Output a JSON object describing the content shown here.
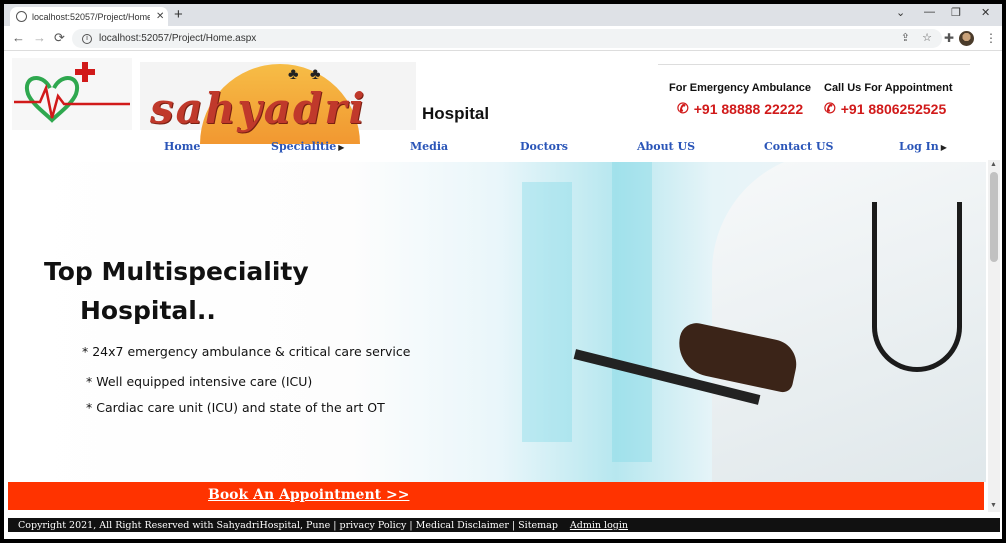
{
  "browser": {
    "tab_title": "localhost:52057/Project/Home.aspx",
    "tab_close": "✕",
    "new_tab": "+",
    "url": "localhost:52057/Project/Home.aspx",
    "win_minimize": "—",
    "win_restore": "❐",
    "win_close": "✕",
    "win_chevron": "⌄"
  },
  "header": {
    "brand_banner": "sahyadri",
    "hospital_word": "Hospital",
    "emergency_label": "For Emergency Ambulance",
    "emergency_phone": "+91 88888 22222",
    "appointment_label": "Call Us For Appointment",
    "appointment_phone": "+91 8806252525"
  },
  "nav": {
    "items": [
      {
        "label": "Home"
      },
      {
        "label": "Specialitie"
      },
      {
        "label": "Media"
      },
      {
        "label": "Doctors"
      },
      {
        "label": "About US"
      },
      {
        "label": "Contact US"
      },
      {
        "label": "Log In"
      }
    ]
  },
  "hero": {
    "title_line1": "Top Multispeciality",
    "title_line2": "Hospital..",
    "points": [
      "* 24x7 emergency ambulance & critical care service",
      "* Well equipped intensive care (ICU)",
      "* Cardiac care unit (ICU) and state of the art OT"
    ]
  },
  "booking": {
    "label": "Book An Appointment >>"
  },
  "footer": {
    "text": "Copyright 2021, All Right Reserved with SahyadriHospital, Pune | privacy Policy | Medical Disclaimer | Sitemap",
    "admin_link": "Admin login"
  },
  "colors": {
    "nav_link": "#2a55b8",
    "phone_red": "#d11a1a",
    "booking_bar": "#ff3300",
    "footer_bg": "#111111"
  }
}
